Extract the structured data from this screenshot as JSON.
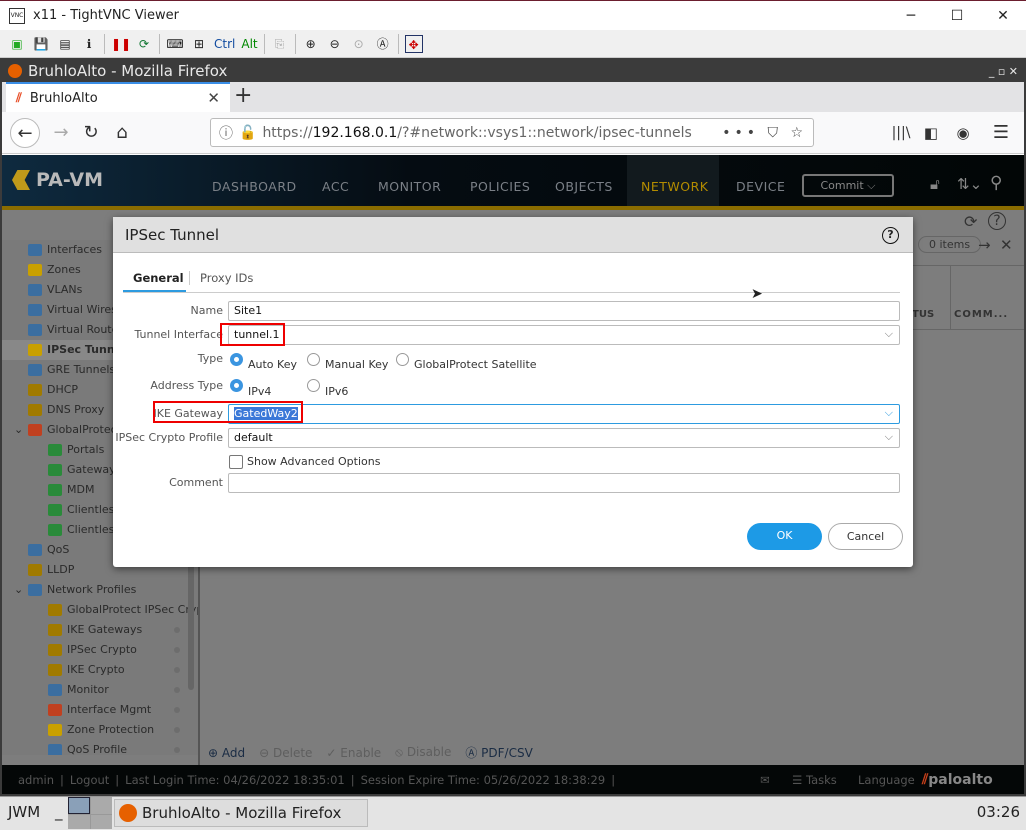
{
  "vnc": {
    "title": "x11 - TightVNC Viewer",
    "toolbar": {
      "ctrl": "Ctrl",
      "alt": "Alt"
    }
  },
  "firefox": {
    "title": "BruhloAlto - Mozilla Firefox",
    "tab": "BruhloAlto",
    "url_prefix": "https://",
    "url_host": "192.168.0.1",
    "url_path": "/?#network::vsys1::network/ipsec-tunnels"
  },
  "pa": {
    "logo": "PA-VM",
    "nav": [
      "DASHBOARD",
      "ACC",
      "MONITOR",
      "POLICIES",
      "OBJECTS",
      "NETWORK",
      "DEVICE"
    ],
    "active_nav": "NETWORK",
    "commit": "Commit ⌵"
  },
  "sidebar": {
    "items": [
      {
        "label": "Interfaces",
        "color": "#3b6ea0"
      },
      {
        "label": "Zones",
        "color": "#c9a000"
      },
      {
        "label": "VLANs",
        "color": "#3b6ea0"
      },
      {
        "label": "Virtual Wires",
        "color": "#3b6ea0"
      },
      {
        "label": "Virtual Routers",
        "color": "#3b6ea0"
      },
      {
        "label": "IPSec Tunnels",
        "color": "#c9a000"
      },
      {
        "label": "GRE Tunnels",
        "color": "#3b6ea0"
      },
      {
        "label": "DHCP",
        "color": "#a07a00"
      },
      {
        "label": "DNS Proxy",
        "color": "#a07a00"
      },
      {
        "label": "GlobalProtect",
        "color": "#c04020"
      },
      {
        "label": "Portals",
        "color": "#2a8a3a"
      },
      {
        "label": "Gateways",
        "color": "#2a8a3a"
      },
      {
        "label": "MDM",
        "color": "#2a8a3a"
      },
      {
        "label": "Clientless Apps",
        "color": "#2a8a3a"
      },
      {
        "label": "Clientless App Groups",
        "color": "#2a8a3a"
      },
      {
        "label": "QoS",
        "color": "#3b6ea0"
      },
      {
        "label": "LLDP",
        "color": "#a07a00"
      },
      {
        "label": "Network Profiles",
        "color": "#3b6ea0"
      },
      {
        "label": "GlobalProtect IPSec Crypto",
        "color": "#a07a00"
      },
      {
        "label": "IKE Gateways",
        "color": "#a07a00"
      },
      {
        "label": "IPSec Crypto",
        "color": "#a07a00"
      },
      {
        "label": "IKE Crypto",
        "color": "#a07a00"
      },
      {
        "label": "Monitor",
        "color": "#3b6ea0"
      },
      {
        "label": "Interface Mgmt",
        "color": "#c04020"
      },
      {
        "label": "Zone Protection",
        "color": "#c9a000"
      },
      {
        "label": "QoS Profile",
        "color": "#3b6ea0"
      }
    ],
    "selected": "IPSec Tunnels"
  },
  "table": {
    "items_count": "0 items",
    "columns": [
      "TUS",
      "COMM..."
    ]
  },
  "actions": {
    "add": "Add",
    "delete": "Delete",
    "enable": "Enable",
    "disable": "Disable",
    "pdf": "PDF/CSV"
  },
  "dialog": {
    "title": "IPSec Tunnel",
    "tabs": [
      "General",
      "Proxy IDs"
    ],
    "active_tab": "General",
    "name_label": "Name",
    "name": "Site1",
    "tunnel_label": "Tunnel Interface",
    "tunnel": "tunnel.1",
    "type_label": "Type",
    "type_options": [
      "Auto Key",
      "Manual Key",
      "GlobalProtect Satellite"
    ],
    "type_selected": "Auto Key",
    "addr_label": "Address Type",
    "addr_options": [
      "IPv4",
      "IPv6"
    ],
    "addr_selected": "IPv4",
    "ike_label": "IKE Gateway",
    "ike": "GatedWay2",
    "crypto_label": "IPSec Crypto Profile",
    "crypto": "default",
    "advanced_label": "Show Advanced Options",
    "advanced_checked": false,
    "comment_label": "Comment",
    "comment": "",
    "ok": "OK",
    "cancel": "Cancel"
  },
  "status": {
    "user": "admin",
    "logout": "Logout",
    "last_login": "Last Login Time: 04/26/2022 18:35:01",
    "session": "Session Expire Time: 05/26/2022 18:38:29",
    "tasks": "Tasks",
    "language": "Language",
    "brand": "paloalto"
  },
  "taskbar": {
    "wm": "JWM",
    "window": "BruhloAlto - Mozilla Firefox",
    "clock": "03:26"
  }
}
